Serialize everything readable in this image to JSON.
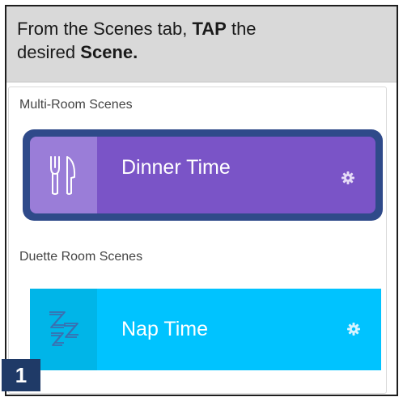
{
  "header": {
    "line1_prefix": "From the Scenes tab,",
    "line1_bold": "TAP",
    "line1_suffix": "the",
    "line2_prefix": "desired",
    "line2_bold": "Scene."
  },
  "sections": {
    "multi_room_label": "Multi-Room Scenes",
    "duette_room_label": "Duette Room Scenes"
  },
  "scenes": [
    {
      "name": "Dinner Time",
      "icon": "fork-knife-icon",
      "selected": true,
      "color": "#7a54c7",
      "icon_tile_color": "#9a7dd8"
    },
    {
      "name": "Nap Time",
      "icon": "zzz-icon",
      "selected": false,
      "color": "#00c3ff",
      "icon_tile_color": "#00b5e8"
    }
  ],
  "selection_outline_color": "#2f4a8a",
  "step_badge": "1"
}
